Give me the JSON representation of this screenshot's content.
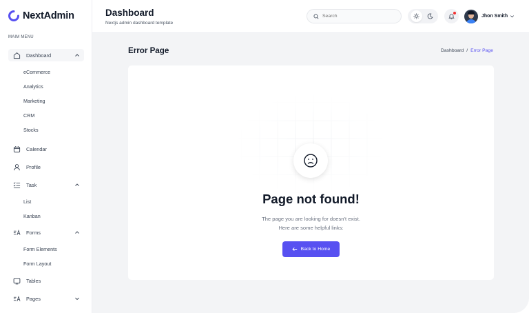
{
  "app": {
    "name": "NextAdmin",
    "brand_color": "#5750f1"
  },
  "sidebar": {
    "caption": "MAIM MENU",
    "items": [
      {
        "label": "Dashboard",
        "icon": "home-icon",
        "expanded": true,
        "children": [
          "eCommerce",
          "Analytics",
          "Marketing",
          "CRM",
          "Stocks"
        ]
      },
      {
        "label": "Calendar",
        "icon": "calendar-icon"
      },
      {
        "label": "Profile",
        "icon": "user-icon"
      },
      {
        "label": "Task",
        "icon": "task-list-icon",
        "expanded": true,
        "children": [
          "List",
          "Kanban"
        ]
      },
      {
        "label": "Forms",
        "icon": "forms-icon",
        "expanded": true,
        "children": [
          "Form Elements",
          "Form Layout"
        ]
      },
      {
        "label": "Tables",
        "icon": "table-icon"
      },
      {
        "label": "Pages",
        "icon": "pages-icon",
        "expanded": false
      }
    ]
  },
  "header": {
    "title": "Dashboard",
    "subtitle": "Nextjs admin dashboard template",
    "search_placeholder": "Search",
    "theme": {
      "light_icon": "sun-icon",
      "dark_icon": "moon-icon",
      "active": "light"
    },
    "notification_icon": "bell-icon",
    "user_name": "Jhon Smith"
  },
  "main": {
    "page_title": "Error Page",
    "breadcrumb": {
      "parent": "Dashboard",
      "separator": "/",
      "current": "Error Page"
    },
    "error_card": {
      "emoji_icon": "sad-face-icon",
      "heading": "Page not found!",
      "description_line1": "The page you are looking for doesn't exist.",
      "description_line2": "Here are some helpful links:",
      "button_label": "Back to Home",
      "button_icon": "arrow-left-icon"
    }
  }
}
